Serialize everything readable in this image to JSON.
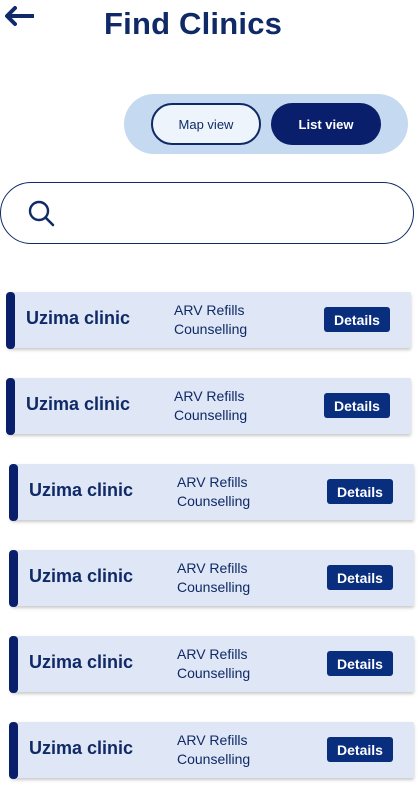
{
  "header": {
    "title": "Find Clinics",
    "back_icon": "arrow-left-icon"
  },
  "view_toggle": {
    "map_label": "Map view",
    "list_label": "List view",
    "selected": "List view"
  },
  "search": {
    "value": "",
    "placeholder": "",
    "icon": "search-icon"
  },
  "clinics": [
    {
      "name": "Uzima clinic",
      "service_1": "ARV Refills",
      "service_2": "Counselling",
      "action": "Details"
    },
    {
      "name": "Uzima clinic",
      "service_1": "ARV Refills",
      "service_2": "Counselling",
      "action": "Details"
    },
    {
      "name": "Uzima clinic",
      "service_1": "ARV Refills",
      "service_2": "Counselling",
      "action": "Details"
    },
    {
      "name": "Uzima clinic",
      "service_1": "ARV Refills",
      "service_2": "Counselling",
      "action": "Details"
    },
    {
      "name": "Uzima clinic",
      "service_1": "ARV Refills",
      "service_2": "Counselling",
      "action": "Details"
    },
    {
      "name": "Uzima clinic",
      "service_1": "ARV Refills",
      "service_2": "Counselling",
      "action": "Details"
    }
  ],
  "colors": {
    "primary": "#0a1f6b",
    "toggle_bg": "#c5d9f0",
    "card_bg": "#dfe6f6"
  }
}
